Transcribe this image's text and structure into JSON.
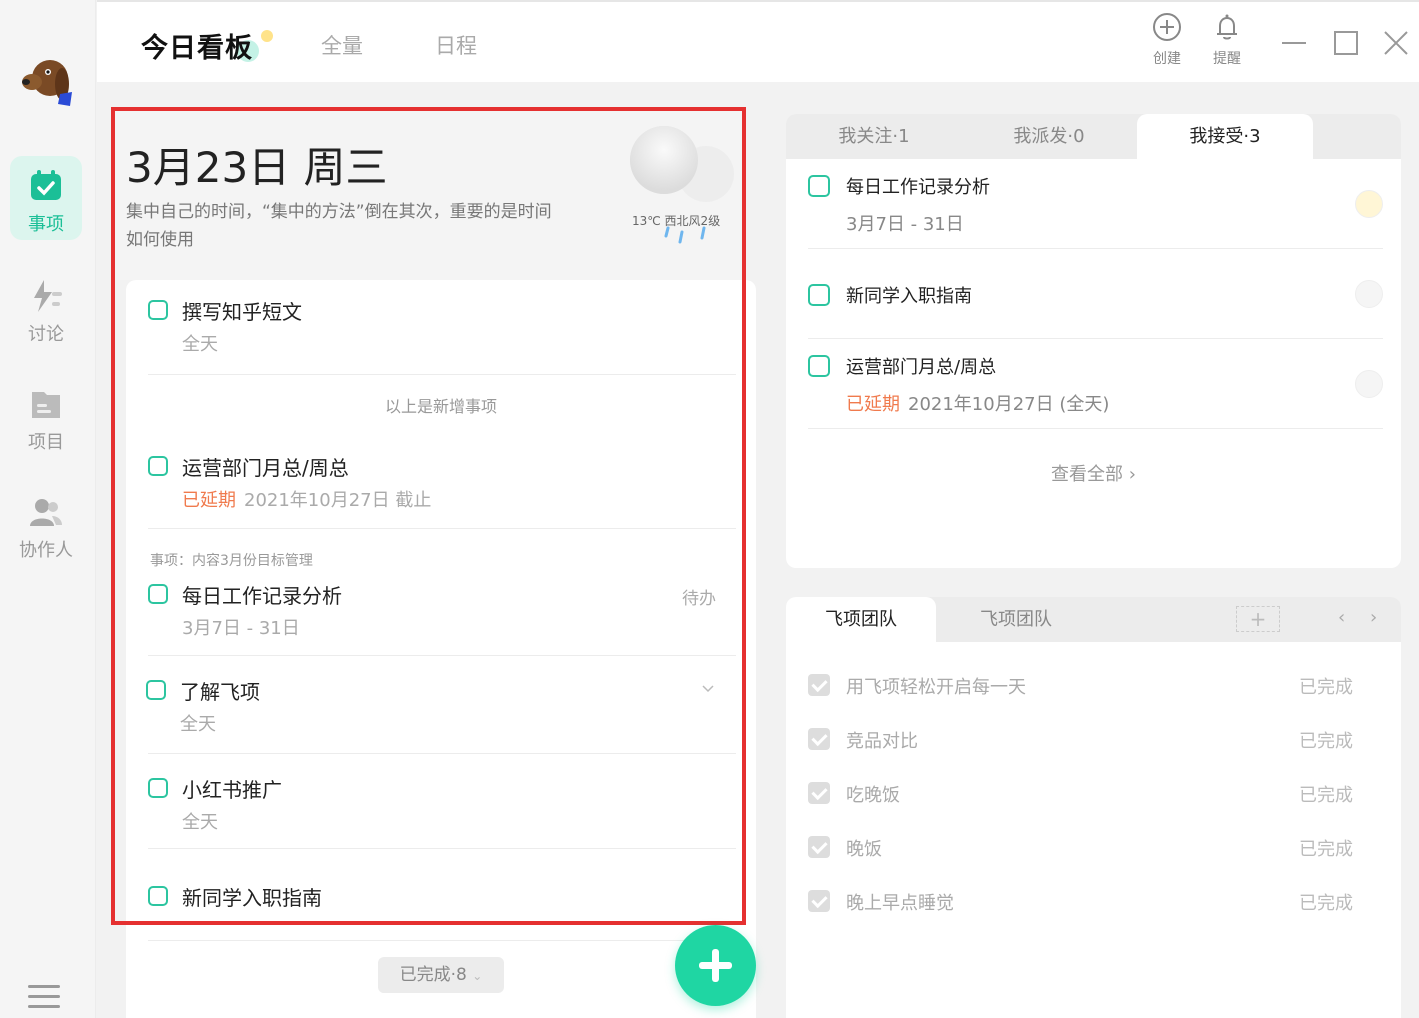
{
  "sidebar": {
    "items": [
      {
        "label": "事项",
        "icon": "calendar-check-icon",
        "active": true
      },
      {
        "label": "讨论",
        "icon": "lightning-icon",
        "active": false
      },
      {
        "label": "项目",
        "icon": "folder-icon",
        "active": false
      },
      {
        "label": "协作人",
        "icon": "people-icon",
        "active": false
      }
    ]
  },
  "topbar": {
    "title": "今日看板",
    "tabs": [
      "全量",
      "日程"
    ],
    "tools": [
      {
        "label": "创建",
        "icon": "plus-circle-icon"
      },
      {
        "label": "提醒",
        "icon": "bell-icon"
      }
    ]
  },
  "header": {
    "date": "3月23日 周三",
    "quote": "集中自己的时间，“集中的方法”倒在其次，重要的是时间如何使用",
    "weather": "13℃ 西北风2级"
  },
  "tasks": {
    "t1": {
      "title": "撰写知乎短文",
      "sub": "全天"
    },
    "new_note": "以上是新增事项",
    "t2": {
      "title": "运营部门月总/周总",
      "overdue": "已延期",
      "sub": "2021年10月27日 截止"
    },
    "category": "事项：内容3月份目标管理",
    "t3": {
      "title": "每日工作记录分析",
      "sub": "3月7日 - 31日",
      "status": "待办"
    },
    "t4": {
      "title": "了解飞项",
      "sub": "全天"
    },
    "t5": {
      "title": "小红书推广",
      "sub": "全天"
    },
    "t6": {
      "title": "新同学入职指南"
    },
    "completed": "已完成·8"
  },
  "assigned": {
    "tabs": [
      "我关注·1",
      "我派发·0",
      "我接受·3"
    ],
    "r1": {
      "title": "每日工作记录分析",
      "sub": "3月7日 - 31日"
    },
    "r2": {
      "title": "新同学入职指南"
    },
    "r3": {
      "title": "运营部门月总/周总",
      "overdue": "已延期",
      "sub": "2021年10月27日 (全天)"
    },
    "view_all": "查看全部"
  },
  "team": {
    "tabs": [
      "飞项团队",
      "飞项团队"
    ],
    "add": "+",
    "prev": "‹",
    "next": "›",
    "rows": [
      {
        "title": "用飞项轻松开启每一天",
        "status": "已完成"
      },
      {
        "title": "竞品对比",
        "status": "已完成"
      },
      {
        "title": "吃晚饭",
        "status": "已完成"
      },
      {
        "title": "晚饭",
        "status": "已完成"
      },
      {
        "title": "晚上早点睡觉",
        "status": "已完成"
      }
    ]
  },
  "colors": {
    "accent": "#1fd6a3",
    "overdue": "#f07a4d",
    "highlight": "#e53030"
  }
}
